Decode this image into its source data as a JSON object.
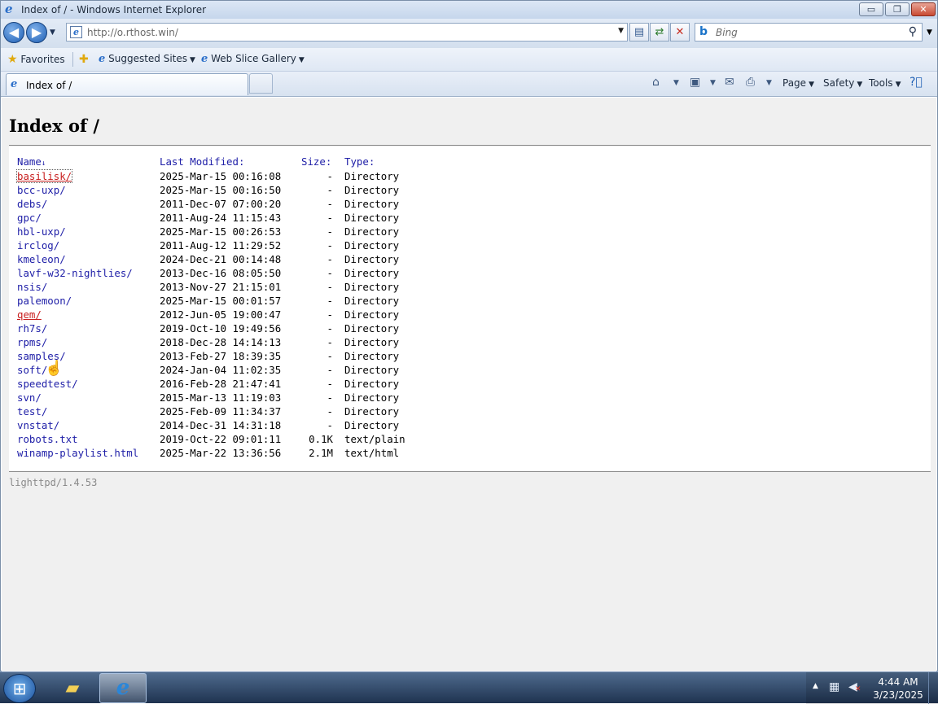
{
  "window": {
    "title": "Index of / - Windows Internet Explorer",
    "buttons": {
      "minimize": "▭",
      "maximize": "❐",
      "close": "✕"
    }
  },
  "nav": {
    "back_icon": "back-arrow-icon",
    "forward_icon": "forward-arrow-icon",
    "address_url": "http://o.rthost.win/",
    "search_placeholder": "Bing"
  },
  "favorites_bar": {
    "favorites_label": "Favorites",
    "suggested_sites": "Suggested Sites",
    "web_slice_gallery": "Web Slice Gallery"
  },
  "tabs": [
    {
      "label": "Index of /"
    }
  ],
  "command_bar": {
    "page": "Page",
    "safety": "Safety",
    "tools": "Tools"
  },
  "page": {
    "heading": "Index of /",
    "columns": {
      "name": "Name",
      "sort_arrow": "↓",
      "modified": "Last Modified:",
      "size": "Size:",
      "type": "Type:"
    },
    "rows": [
      {
        "name": "basilisk/",
        "modified": "2025-Mar-15 00:16:08",
        "size": "-",
        "type": "Directory"
      },
      {
        "name": "bcc-uxp/",
        "modified": "2025-Mar-15 00:16:50",
        "size": "-",
        "type": "Directory"
      },
      {
        "name": "debs/",
        "modified": "2011-Dec-07 07:00:20",
        "size": "-",
        "type": "Directory"
      },
      {
        "name": "gpc/",
        "modified": "2011-Aug-24 11:15:43",
        "size": "-",
        "type": "Directory"
      },
      {
        "name": "hbl-uxp/",
        "modified": "2025-Mar-15 00:26:53",
        "size": "-",
        "type": "Directory"
      },
      {
        "name": "irclog/",
        "modified": "2011-Aug-12 11:29:52",
        "size": "-",
        "type": "Directory"
      },
      {
        "name": "kmeleon/",
        "modified": "2024-Dec-21 00:14:48",
        "size": "-",
        "type": "Directory"
      },
      {
        "name": "lavf-w32-nightlies/",
        "modified": "2013-Dec-16 08:05:50",
        "size": "-",
        "type": "Directory"
      },
      {
        "name": "nsis/",
        "modified": "2013-Nov-27 21:15:01",
        "size": "-",
        "type": "Directory"
      },
      {
        "name": "palemoon/",
        "modified": "2025-Mar-15 00:01:57",
        "size": "-",
        "type": "Directory"
      },
      {
        "name": "qem/",
        "modified": "2012-Jun-05 19:00:47",
        "size": "-",
        "type": "Directory"
      },
      {
        "name": "rh7s/",
        "modified": "2019-Oct-10 19:49:56",
        "size": "-",
        "type": "Directory"
      },
      {
        "name": "rpms/",
        "modified": "2018-Dec-28 14:14:13",
        "size": "-",
        "type": "Directory"
      },
      {
        "name": "samples/",
        "modified": "2013-Feb-27 18:39:35",
        "size": "-",
        "type": "Directory"
      },
      {
        "name": "soft/",
        "modified": "2024-Jan-04 11:02:35",
        "size": "-",
        "type": "Directory"
      },
      {
        "name": "speedtest/",
        "modified": "2016-Feb-28 21:47:41",
        "size": "-",
        "type": "Directory"
      },
      {
        "name": "svn/",
        "modified": "2015-Mar-13 11:19:03",
        "size": "-",
        "type": "Directory"
      },
      {
        "name": "test/",
        "modified": "2025-Feb-09 11:34:37",
        "size": "-",
        "type": "Directory"
      },
      {
        "name": "vnstat/",
        "modified": "2014-Dec-31 14:31:18",
        "size": "-",
        "type": "Directory"
      },
      {
        "name": "robots.txt",
        "modified": "2019-Oct-22 09:01:11",
        "size": "0.1K",
        "type": "text/plain"
      },
      {
        "name": "winamp-playlist.html",
        "modified": "2025-Mar-22 13:36:56",
        "size": "2.1M",
        "type": "text/html"
      }
    ],
    "footer": "lighttpd/1.4.53"
  },
  "taskbar": {
    "clock_time": "4:44 AM",
    "clock_date": "3/23/2025"
  },
  "colors": {
    "link": "#2020a8",
    "visited_hover": "#c81e1e",
    "content_bg": "#f0f0f0"
  }
}
